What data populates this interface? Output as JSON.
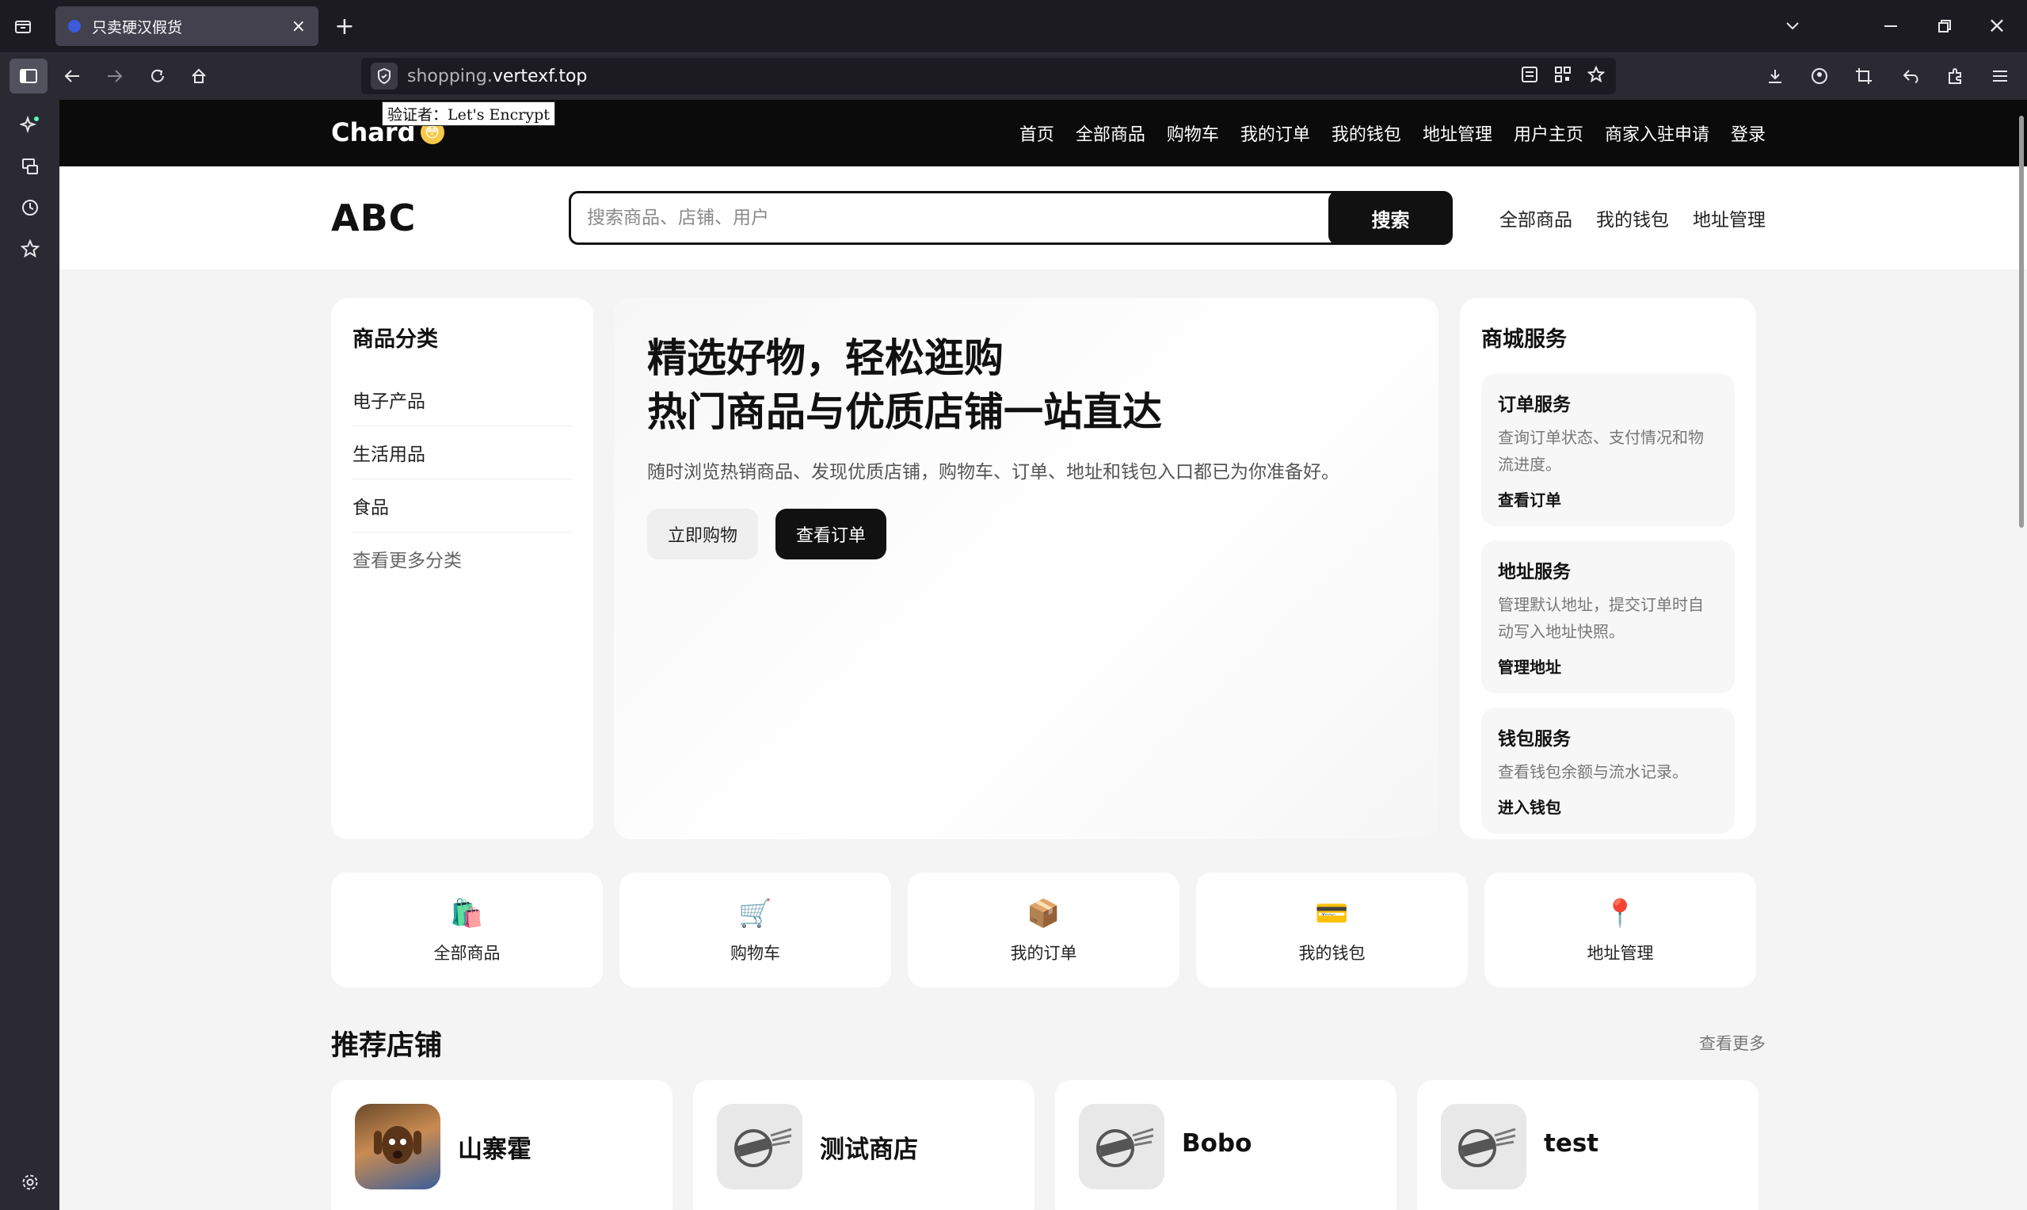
{
  "browser": {
    "tab_title": "只卖硬汉假货",
    "url_host_dim": "shopping.",
    "url_host": "vertexf.top",
    "tooltip": "验证者：Let's Encrypt"
  },
  "site": {
    "brand": "Chard",
    "brand_emoji": "😳",
    "nav": [
      "首页",
      "全部商品",
      "购物车",
      "我的订单",
      "我的钱包",
      "地址管理",
      "用户主页",
      "商家入驻申请",
      "登录"
    ],
    "logo": "ABC",
    "search_placeholder": "搜索商品、店铺、用户",
    "search_button": "搜索",
    "quick_links": [
      "全部商品",
      "我的钱包",
      "地址管理"
    ]
  },
  "categories": {
    "title": "商品分类",
    "items": [
      "电子产品",
      "生活用品",
      "食品"
    ],
    "more": "查看更多分类"
  },
  "hero": {
    "line1": "精选好物，轻松逛购",
    "line2": "热门商品与优质店铺一站直达",
    "desc": "随时浏览热销商品、发现优质店铺，购物车、订单、地址和钱包入口都已为你准备好。",
    "btn_shop": "立即购物",
    "btn_orders": "查看订单"
  },
  "services": {
    "title": "商城服务",
    "items": [
      {
        "title": "订单服务",
        "desc": "查询订单状态、支付情况和物流进度。",
        "link": "查看订单"
      },
      {
        "title": "地址服务",
        "desc": "管理默认地址，提交订单时自动写入地址快照。",
        "link": "管理地址"
      },
      {
        "title": "钱包服务",
        "desc": "查看钱包余额与流水记录。",
        "link": "进入钱包"
      }
    ]
  },
  "tiles": [
    {
      "label": "全部商品",
      "icon": "shopping-bags-icon",
      "glyph": "🛍️"
    },
    {
      "label": "购物车",
      "icon": "cart-icon",
      "glyph": "🛒"
    },
    {
      "label": "我的订单",
      "icon": "package-icon",
      "glyph": "📦"
    },
    {
      "label": "我的钱包",
      "icon": "credit-card-icon",
      "glyph": "💳"
    },
    {
      "label": "地址管理",
      "icon": "pin-icon",
      "glyph": "📍"
    }
  ],
  "shops": {
    "title": "推荐店铺",
    "more": "查看更多",
    "items": [
      {
        "name": "山寨霍",
        "avatar": "face-avatar"
      },
      {
        "name": "测试商店",
        "avatar": "sold-stamp-avatar"
      },
      {
        "name": "Bobo",
        "avatar": "sold-stamp-avatar"
      },
      {
        "name": "test",
        "avatar": "sold-stamp-avatar"
      }
    ]
  },
  "colors": {
    "accent": "#111111",
    "page_bg": "#f4f4f4",
    "nav_bg": "#0b0b0b"
  }
}
